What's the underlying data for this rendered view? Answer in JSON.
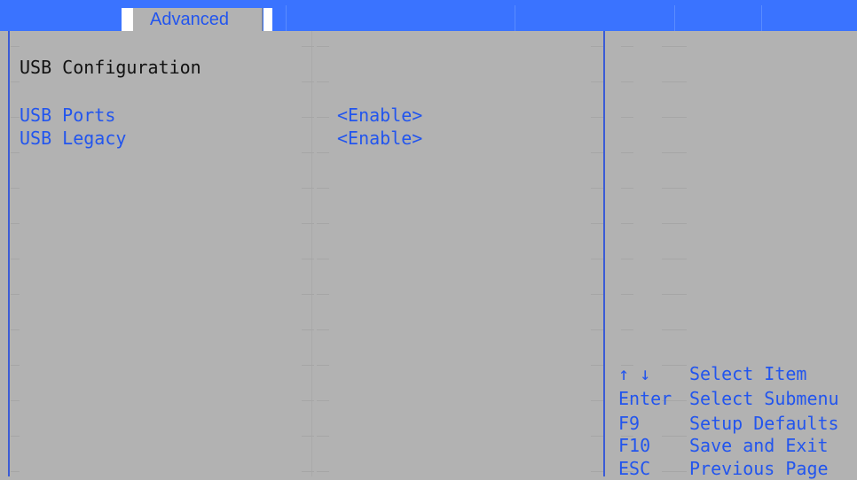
{
  "top_tab": {
    "label": "Advanced"
  },
  "section": {
    "title": "USB Configuration"
  },
  "settings": [
    {
      "label": "USB Ports",
      "value": "<Enable>"
    },
    {
      "label": "USB Legacy",
      "value": "<Enable>"
    }
  ],
  "help_keys": [
    {
      "key": "↑ ↓",
      "desc": "Select Item"
    },
    {
      "key": "Enter",
      "desc": "Select Submenu"
    },
    {
      "key": "F9",
      "desc": "Setup Defaults"
    },
    {
      "key": "F10",
      "desc": "Save and Exit"
    },
    {
      "key": "ESC",
      "desc": "Previous Page"
    }
  ],
  "colors": {
    "background": "#b2b2b2",
    "bar": "#3a73ff",
    "accent_text": "#2255ee",
    "heading_text": "#111111",
    "divider": "#3a5bd6"
  }
}
